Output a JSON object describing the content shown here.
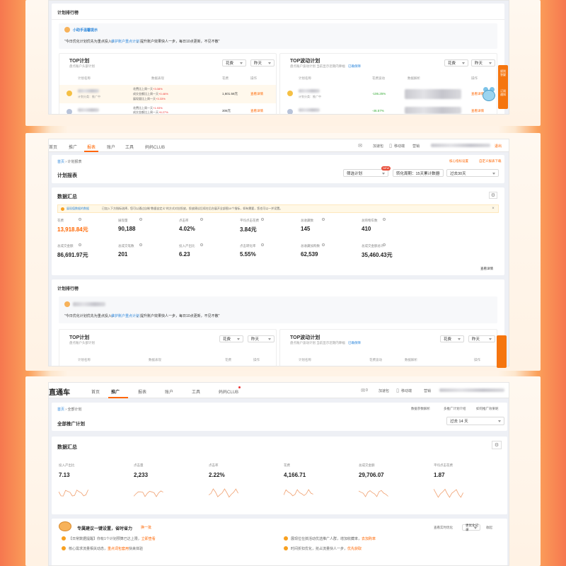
{
  "s1": {
    "ranking_title": "计划排行榜",
    "assistant_name": "小助手温馨提示",
    "tip_a": "\"今日优化计划优先为重点投入，",
    "tip_link": "维护账户重点计划",
    "tip_b": "，提升账户效果快人一步，每日10点更新，不见不散\"",
    "top_plan": "TOP计划",
    "top_plan_sub": "盘点账户头部计划",
    "top_drop": "TOP波动计划",
    "top_drop_sub": "盘点账户波动计划 当前显示近期内降幅",
    "drop_link": "已确保降",
    "sel_spend": "花费",
    "sel_yesterday": "昨天",
    "cols_left": [
      "计划名称",
      "数据表现",
      "花费",
      "操作"
    ],
    "cols_right": [
      "计划名称",
      "花费波动",
      "数据解析",
      "操作"
    ],
    "rows_left": [
      {
        "lines": [
          "花费比上周一天+3.08%",
          "成交金额比上周一天+0.46%",
          "展现量比上周一天+3.33%"
        ],
        "spend": "1,601.56元",
        "action": "查看详情"
      },
      {
        "lines": [
          "花费比上周一天+1.93%",
          "成交金额比上周一天+6.27%",
          "展现量比上周一天+8.14%"
        ],
        "spend": "306元",
        "action": "查看详情"
      }
    ],
    "rows_right": [
      {
        "sub": "计划分类：推广中",
        "change": "-106.25%",
        "action": "查看详情"
      },
      {
        "sub": "",
        "change": "-46.57%",
        "action": "查看详情"
      }
    ],
    "side_labels": [
      "规则答疑",
      "订阅通知"
    ]
  },
  "s2": {
    "nav": [
      "首页",
      "推广",
      "报表",
      "账户",
      "工具",
      "妈妈CLUB"
    ],
    "breadcrumb": [
      "首页",
      "计划报表"
    ],
    "header_links": [
      "加速包",
      "移动端",
      "营销",
      "退出"
    ],
    "head_right": [
      "核心指标设置",
      "自定义报表下载"
    ],
    "page_title": "计划报表",
    "filter": "筛选计划",
    "filter_new": "NEW",
    "attr_select": "转化周期：15天累计数据",
    "date_select": "过去30天",
    "summary_title": "数据汇总",
    "notice_link": "展现值数据的数据",
    "notice_text": "已加入下方指标选择，您可以通过自制\"数据自定义\"的方式对应投放，投放建议后续在后台展开全部图10个指标，如有需要，您也可以一并设置。",
    "metrics": [
      {
        "label": "花费",
        "value": "13,918.84元",
        "accent": true
      },
      {
        "label": "展现量",
        "value": "90,188"
      },
      {
        "label": "点击率",
        "value": "4.02%"
      },
      {
        "label": "平均点击花费",
        "value": "3.84元"
      },
      {
        "label": "总收藏数",
        "value": "145"
      },
      {
        "label": "总购物车数",
        "value": "410"
      },
      {
        "label": "总成交金额",
        "value": "86,691.97元"
      },
      {
        "label": "总成交笔数",
        "value": "201"
      },
      {
        "label": "投入产出比",
        "value": "6.23"
      },
      {
        "label": "点击转化率",
        "value": "5.55%"
      },
      {
        "label": "总收藏加购数",
        "value": "62,539"
      },
      {
        "label": "总成交金额总计",
        "value": "35,460.43元"
      }
    ],
    "more": "查看详情",
    "ranking_title": "计划排行榜",
    "tip_a": "\"今日优化计划优先为重点投入，",
    "tip_link": "维护账户重点计划",
    "tip_b": "，提升账户效果快人一步，每日10点更新，不见不散\"",
    "top_plan": "TOP计划",
    "top_plan_sub": "盘点账户头部计划",
    "top_drop": "TOP波动计划",
    "top_drop_sub": "盘点账户波动计划 当前显示近期内降幅",
    "drop_link": "已确保降",
    "sel_spend": "花费",
    "sel_yesterday": "昨天",
    "cols_left": [
      "计划名称",
      "数据表现",
      "花费",
      "操作"
    ],
    "cols_right": [
      "计划名称",
      "花费波动",
      "数据解析",
      "操作"
    ]
  },
  "s3": {
    "logo": "直通车",
    "nav": [
      "首页",
      "推广",
      "报表",
      "账户",
      "工具",
      "妈妈CLUB"
    ],
    "header_links": [
      "加速包",
      "移动端",
      "营销"
    ],
    "header_badge": "0",
    "breadcrumb": [
      "首页",
      "全部计划"
    ],
    "head_right": [
      "数据参数解析",
      "多推广计划介绍",
      "如何推广效果呢"
    ],
    "page_title": "全部推广计划",
    "date_select": "过去 14 天",
    "summary_title": "数据汇总",
    "metrics": [
      {
        "label": "投入产出比",
        "value": "7.13"
      },
      {
        "label": "点击量",
        "value": "2,233"
      },
      {
        "label": "点击率",
        "value": "2.22%"
      },
      {
        "label": "花费",
        "value": "4,166.71"
      },
      {
        "label": "总成交金额",
        "value": "29,706.07"
      },
      {
        "label": "平均点击花费",
        "value": "1.87"
      }
    ],
    "suggest_title": "专属建议一键设置，省时省力",
    "suggest_refresh": "换一批",
    "suggest_view": "查看实时优化",
    "suggest_record": "更优化记录",
    "suggest_collapse": "收起",
    "suggestions": [
      {
        "text": "【日常数据提醒】你有1个计划预算已达上限，",
        "link": "立即查看"
      },
      {
        "text": "展现位在搞活动优选推广人群，增加收藏率，",
        "link": "去加购率"
      },
      {
        "text": "核心需求流量相关动态，",
        "link": "重点词包套用",
        "tail": "快来体验"
      },
      {
        "text": "时间折扣优化，抢占流量快人一步，",
        "link": "优先获取"
      }
    ]
  },
  "colors": {
    "accent": "#f60",
    "link": "#3089dc",
    "side": "#f5750f",
    "bg_edge": "#f6774f"
  }
}
